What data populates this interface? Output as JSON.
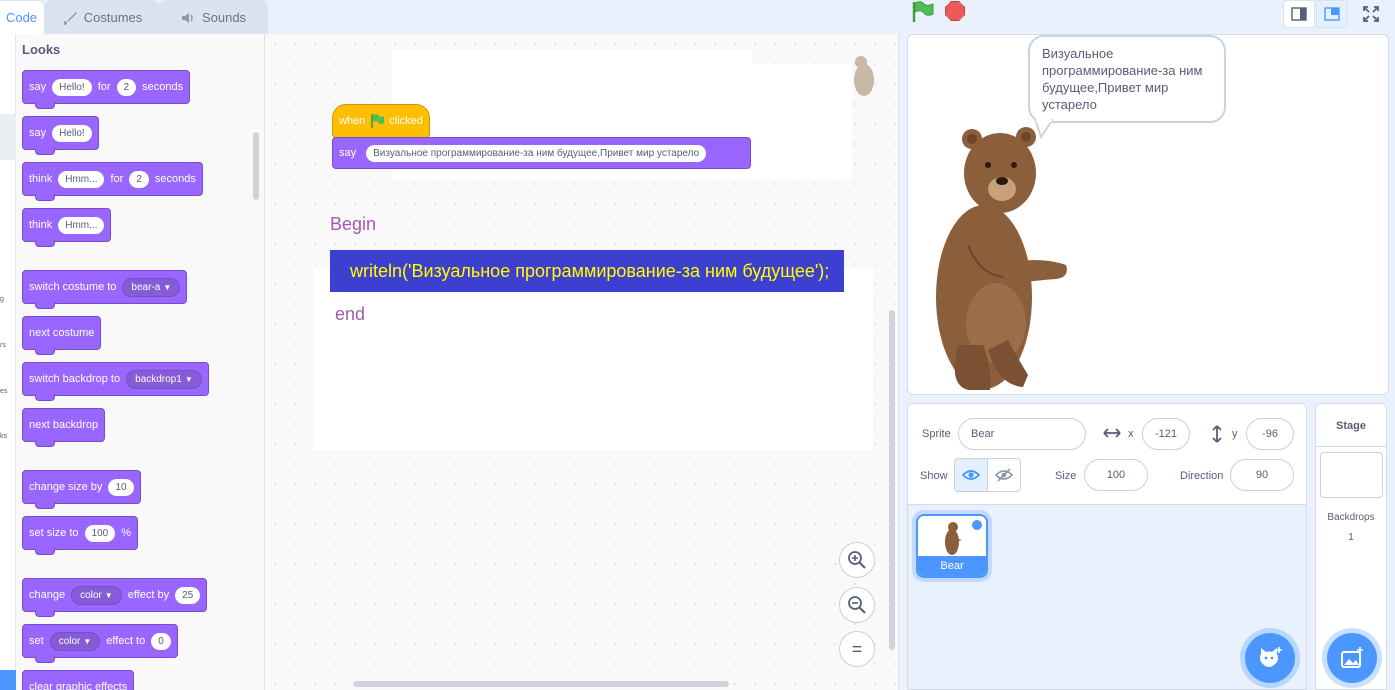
{
  "tabs": {
    "code": "Code",
    "costumes": "Costumes",
    "sounds": "Sounds"
  },
  "category_strip": [
    "g",
    "rs",
    "es",
    "ks"
  ],
  "palette": {
    "title": "Looks",
    "blocks": {
      "say_for": {
        "say": "say",
        "text": "Hello!",
        "for": "for",
        "secs": "2",
        "seconds": "seconds"
      },
      "say": {
        "say": "say",
        "text": "Hello!"
      },
      "think_for": {
        "think": "think",
        "text": "Hmm...",
        "for": "for",
        "secs": "2",
        "seconds": "seconds"
      },
      "think": {
        "think": "think",
        "text": "Hmm..."
      },
      "switch_costume": {
        "label": "switch costume to",
        "value": "bear-a"
      },
      "next_costume": {
        "label": "next costume"
      },
      "switch_backdrop": {
        "label": "switch backdrop to",
        "value": "backdrop1"
      },
      "next_backdrop": {
        "label": "next backdrop"
      },
      "change_size": {
        "label": "change size by",
        "value": "10"
      },
      "set_size": {
        "label": "set size to",
        "value": "100",
        "unit": "%"
      },
      "change_effect": {
        "change": "change",
        "effect": "color",
        "by": "effect by",
        "value": "25"
      },
      "set_effect": {
        "set": "set",
        "effect": "color",
        "to": "effect to",
        "value": "0"
      },
      "clear_effects": {
        "label": "clear graphic effects"
      }
    }
  },
  "script": {
    "hat": {
      "when": "when",
      "clicked": "clicked"
    },
    "say": {
      "label": "say",
      "text": "Визуальное программирование-за ним будущее,Привет мир устарело"
    },
    "pascal": {
      "begin": "Begin",
      "line": "writeln('Визуальное программирование-за ним будущее');",
      "end": "end"
    },
    "zoom": {
      "in": "+",
      "out": "−",
      "reset": "="
    }
  },
  "stage": {
    "bubble": "Визуальное программирование-за ним будущее,Привет мир устарело"
  },
  "sprite_info": {
    "sprite_label": "Sprite",
    "sprite_name": "Bear",
    "x_label": "x",
    "x": "-121",
    "y_label": "y",
    "y": "-96",
    "show_label": "Show",
    "size_label": "Size",
    "size": "100",
    "direction_label": "Direction",
    "direction": "90"
  },
  "sprite_list": [
    {
      "name": "Bear"
    }
  ],
  "stage_panel": {
    "title": "Stage",
    "backdrops_label": "Backdrops",
    "backdrops_count": "1"
  },
  "colors": {
    "looks": "#9966ff",
    "events": "#ffbf00",
    "accent": "#4c97ff",
    "highlight_bg": "#3c3fcf",
    "highlight_text": "#ffff00"
  }
}
